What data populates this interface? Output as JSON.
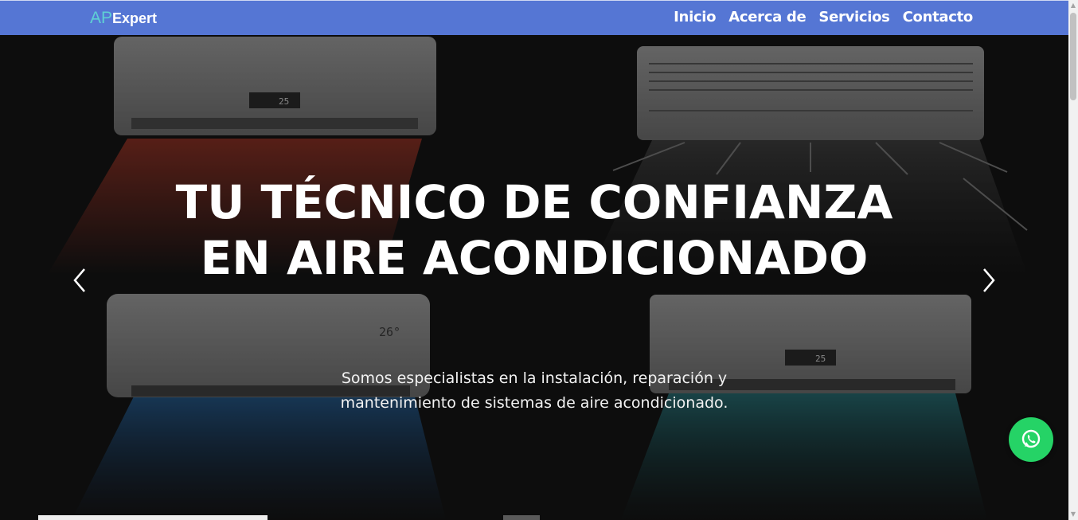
{
  "brand": {
    "ap": "AP",
    "expert": "Expert"
  },
  "nav": {
    "items": [
      "Inicio",
      "Acerca de",
      "Servicios",
      "Contacto"
    ]
  },
  "hero": {
    "title_line1": "TU TÉCNICO DE CONFIANZA",
    "title_line2": "EN AIRE ACONDICIONADO",
    "subtitle_line1": "Somos especialistas en la instalación, reparación y",
    "subtitle_line2": "mantenimiento de sistemas de aire acondicionado.",
    "unit_displays": [
      "25",
      "26°",
      "25"
    ]
  },
  "icons": {
    "prev": "chevron-left-icon",
    "next": "chevron-right-icon",
    "whatsapp": "whatsapp-icon"
  },
  "colors": {
    "navbar": "#5576d4",
    "brand_accent": "#5fd0d4",
    "whatsapp": "#25d366"
  }
}
